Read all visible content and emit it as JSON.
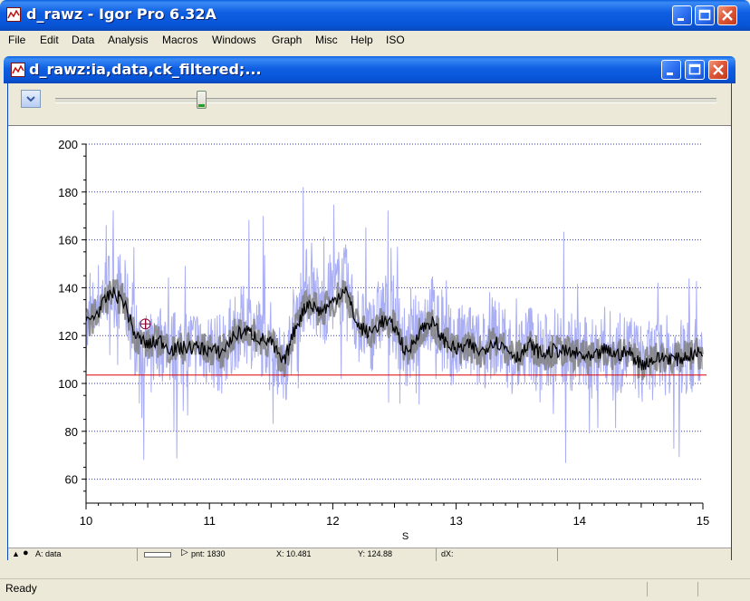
{
  "app": {
    "title": "d_rawz - Igor Pro 6.32A"
  },
  "menu": [
    "File",
    "Edit",
    "Data",
    "Analysis",
    "Macros",
    "Windows",
    "Graph",
    "Misc",
    "Help",
    "ISO"
  ],
  "graph_window": {
    "title": "d_rawz:ia,data,ck_filtered;...",
    "slider_value": 0.22
  },
  "info_panel": {
    "trace": "A: data",
    "pnt": "pnt: 1830",
    "x": "X: 10.481",
    "y": "Y: 124.88",
    "dx": "dX:"
  },
  "status": {
    "text": "Ready"
  },
  "colors": {
    "raw_trace": "#a9aef5",
    "filtered_trace": "#000000",
    "envelope": "#808080",
    "baseline": "#e00000",
    "grid": "#3a3ab0"
  },
  "chart_data": {
    "type": "line",
    "xlabel": "S",
    "ylabel": "",
    "xlim": [
      10,
      15
    ],
    "ylim": [
      50,
      200
    ],
    "x_ticks": [
      "10",
      "11",
      "12",
      "13",
      "14",
      "15"
    ],
    "y_ticks": [
      "60",
      "80",
      "100",
      "120",
      "140",
      "160",
      "180",
      "200"
    ],
    "grid": "horizontal dotted",
    "baseline_y": 103.5,
    "cursor": {
      "x": 10.481,
      "y": 124.88
    },
    "series": [
      {
        "role": "raw",
        "x": [
          10.0,
          10.1,
          10.2,
          10.3,
          10.4,
          10.5,
          10.6,
          10.7,
          10.8,
          10.9,
          11.0,
          11.1,
          11.2,
          11.3,
          11.4,
          11.5,
          11.6,
          11.7,
          11.8,
          11.9,
          12.0,
          12.1,
          12.2,
          12.3,
          12.4,
          12.5,
          12.6,
          12.7,
          12.8,
          12.9,
          13.0,
          13.1,
          13.2,
          13.3,
          13.4,
          13.5,
          13.6,
          13.7,
          13.8,
          13.9,
          14.0,
          14.1,
          14.2,
          14.3,
          14.4,
          14.5,
          14.6,
          14.7,
          14.8,
          14.9,
          15.0
        ],
        "values": [
          120,
          135,
          140,
          138,
          118,
          112,
          118,
          114,
          115,
          116,
          115,
          112,
          122,
          125,
          120,
          118,
          105,
          128,
          142,
          130,
          138,
          142,
          125,
          120,
          130,
          128,
          112,
          124,
          130,
          118,
          115,
          118,
          112,
          120,
          116,
          110,
          118,
          112,
          115,
          114,
          112,
          110,
          116,
          112,
          114,
          108,
          110,
          112,
          110,
          112,
          112
        ]
      },
      {
        "role": "filtered",
        "x": [
          10.0,
          10.1,
          10.2,
          10.3,
          10.4,
          10.5,
          10.6,
          10.7,
          10.8,
          10.9,
          11.0,
          11.1,
          11.2,
          11.3,
          11.4,
          11.5,
          11.6,
          11.7,
          11.8,
          11.9,
          12.0,
          12.1,
          12.2,
          12.3,
          12.4,
          12.5,
          12.6,
          12.7,
          12.8,
          12.9,
          13.0,
          13.1,
          13.2,
          13.3,
          13.4,
          13.5,
          13.6,
          13.7,
          13.8,
          13.9,
          14.0,
          14.1,
          14.2,
          14.3,
          14.4,
          14.5,
          14.6,
          14.7,
          14.8,
          14.9,
          15.0
        ],
        "values": [
          125,
          130,
          138,
          135,
          120,
          116,
          118,
          114,
          115,
          115,
          114,
          113,
          120,
          122,
          119,
          117,
          108,
          124,
          134,
          130,
          134,
          140,
          124,
          121,
          126,
          124,
          112,
          122,
          126,
          118,
          114,
          116,
          113,
          118,
          115,
          111,
          116,
          112,
          114,
          113,
          112,
          110,
          114,
          112,
          113,
          108,
          110,
          111,
          110,
          112,
          113
        ]
      }
    ]
  }
}
